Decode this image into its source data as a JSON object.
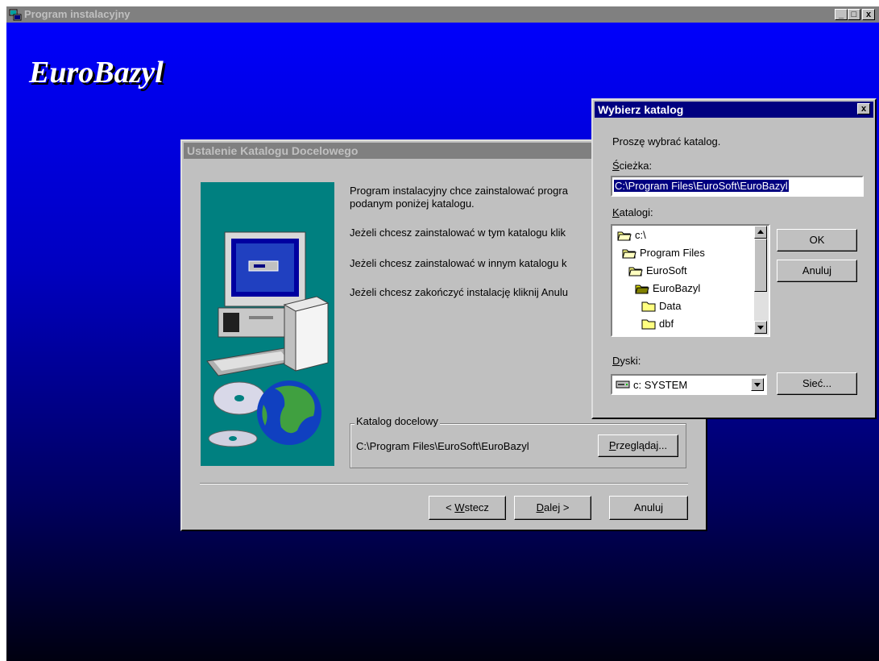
{
  "main_window": {
    "title": "Program instalacyjny",
    "brand": "EuroBazyl",
    "controls": [
      "_",
      "□",
      "x"
    ]
  },
  "setup_dialog": {
    "title": "Ustalenie Katalogu Docelowego",
    "paragraphs": [
      "Program instalacyjny chce zainstalować progra",
      "podanym poniżej katalogu.",
      "Jeżeli chcesz zainstalować w tym katalogu klik",
      "Jeżeli chcesz zainstalować w innym katalogu k",
      "Jeżeli chcesz zakończyć instalację kliknij Anulu"
    ],
    "group_label": "Katalog docelowy",
    "target_path": "C:\\Program Files\\EuroSoft\\EuroBazyl",
    "browse_prefix": "P",
    "browse_rest": "rzeglądaj...",
    "back_prefix": "< ",
    "back_u": "W",
    "back_rest": "stecz",
    "next_u": "D",
    "next_rest": "alej >",
    "cancel_label": "Anuluj"
  },
  "browse_dialog": {
    "title": "Wybierz katalog",
    "close": "x",
    "prompt": "Proszę wybrać katalog.",
    "path_u": "Ś",
    "path_rest": "cieżka:",
    "path_value": "C:\\Program Files\\EuroSoft\\EuroBazyl",
    "dirs_u": "K",
    "dirs_rest": "atalogi:",
    "directories": [
      "c:\\",
      "Program Files",
      "EuroSoft",
      "EuroBazyl",
      "Data",
      "dbf"
    ],
    "drives_u": "D",
    "drives_rest": "yski:",
    "drive_value": "c: SYSTEM",
    "ok_label": "OK",
    "cancel_label": "Anuluj",
    "network_label": "Sieć..."
  }
}
